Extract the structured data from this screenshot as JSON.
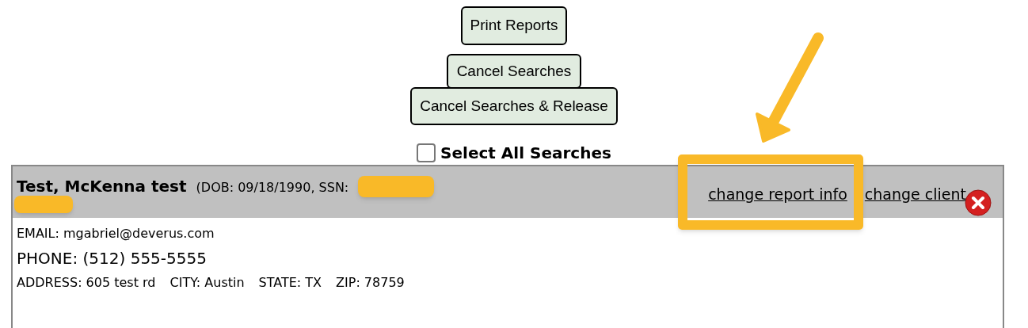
{
  "buttons": [
    {
      "label": "Print Reports"
    },
    {
      "label": "Cancel Searches"
    },
    {
      "label": "Cancel Searches & Release"
    }
  ],
  "select_all": {
    "label": "Select All Searches",
    "checked": false
  },
  "record": {
    "name": "Test, McKenna test",
    "details": "(DOB: 09/18/1990, SSN:",
    "links": [
      "change report info",
      "change client"
    ],
    "email": "EMAIL: mgabriel@deverus.com",
    "phone": "PHONE: (512) 555-5555",
    "address": [
      "ADDRESS: 605 test rd",
      "CITY: Austin",
      "STATE: TX",
      "ZIP: 78759"
    ]
  }
}
